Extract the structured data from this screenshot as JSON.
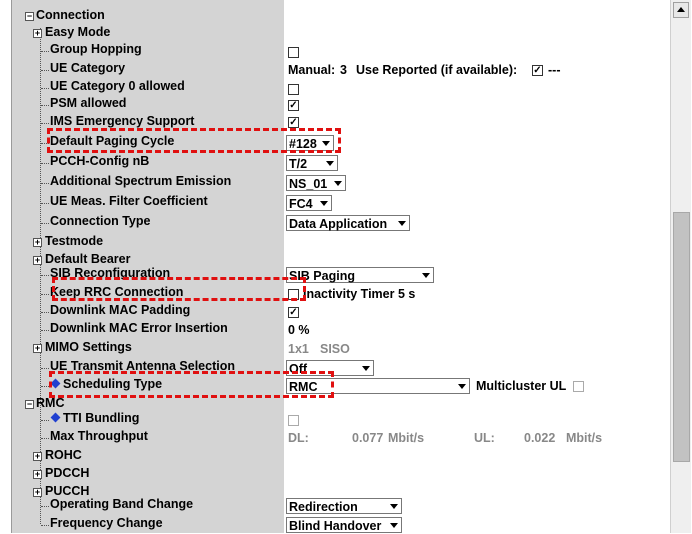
{
  "tree": {
    "connection": "Connection",
    "easy_mode": "Easy Mode",
    "group_hopping": "Group Hopping",
    "ue_category": "UE Category",
    "ue_category0": "UE Category 0 allowed",
    "psm_allowed": "PSM allowed",
    "ims_emergency": "IMS Emergency Support",
    "default_paging": "Default Paging Cycle",
    "pcch_config": "PCCH-Config nB",
    "add_spectrum": "Additional Spectrum Emission",
    "ue_meas": "UE Meas. Filter Coefficient",
    "connection_type": "Connection Type",
    "testmode": "Testmode",
    "default_bearer": "Default Bearer",
    "sib_reconfig": "SIB Reconfiguration",
    "keep_rrc": "Keep RRC Connection",
    "dl_mac_padding": "Downlink MAC Padding",
    "dl_mac_error": "Downlink MAC Error Insertion",
    "mimo": "MIMO Settings",
    "ue_tx_antenna": "UE Transmit Antenna Selection",
    "scheduling_type": "Scheduling Type",
    "rmc": "RMC",
    "tti_bundling": "TTI Bundling",
    "max_throughput": "Max Throughput",
    "rohc": "ROHC",
    "pdcch": "PDCCH",
    "pucch": "PUCCH",
    "op_band_change": "Operating Band Change",
    "freq_change": "Frequency Change"
  },
  "values": {
    "ue_category_manual": "Manual:",
    "ue_category_num": "3",
    "use_reported": "Use Reported (if available):",
    "use_reported_dash": "---",
    "paging_cycle": "#128",
    "pcch_nb": "T/2",
    "spectrum": "NS_01",
    "filter_coef": "FC4",
    "conn_type": "Data Application",
    "sib_paging": "SIB Paging",
    "inactivity": "Inactivity Timer 5 s",
    "dl_mac_error_val": "0 %",
    "mimo_1x1": "1x1",
    "mimo_siso": "SISO",
    "tx_antenna": "Off",
    "sched_type": "RMC",
    "multicluster": "Multicluster UL",
    "dl_label": "DL:",
    "dl_value": "0.077",
    "dl_unit": "Mbit/s",
    "ul_label": "UL:",
    "ul_value": "0.022",
    "ul_unit": "Mbit/s",
    "op_band_val": "Redirection",
    "freq_change_val": "Blind Handover",
    "check_mark": "✓"
  },
  "icons": {
    "expand": "+",
    "collapse": "−"
  },
  "colors": {
    "highlight_dash": "#e01010",
    "diamond": "#2040d0",
    "tree_bg": "#d4d4d4"
  }
}
